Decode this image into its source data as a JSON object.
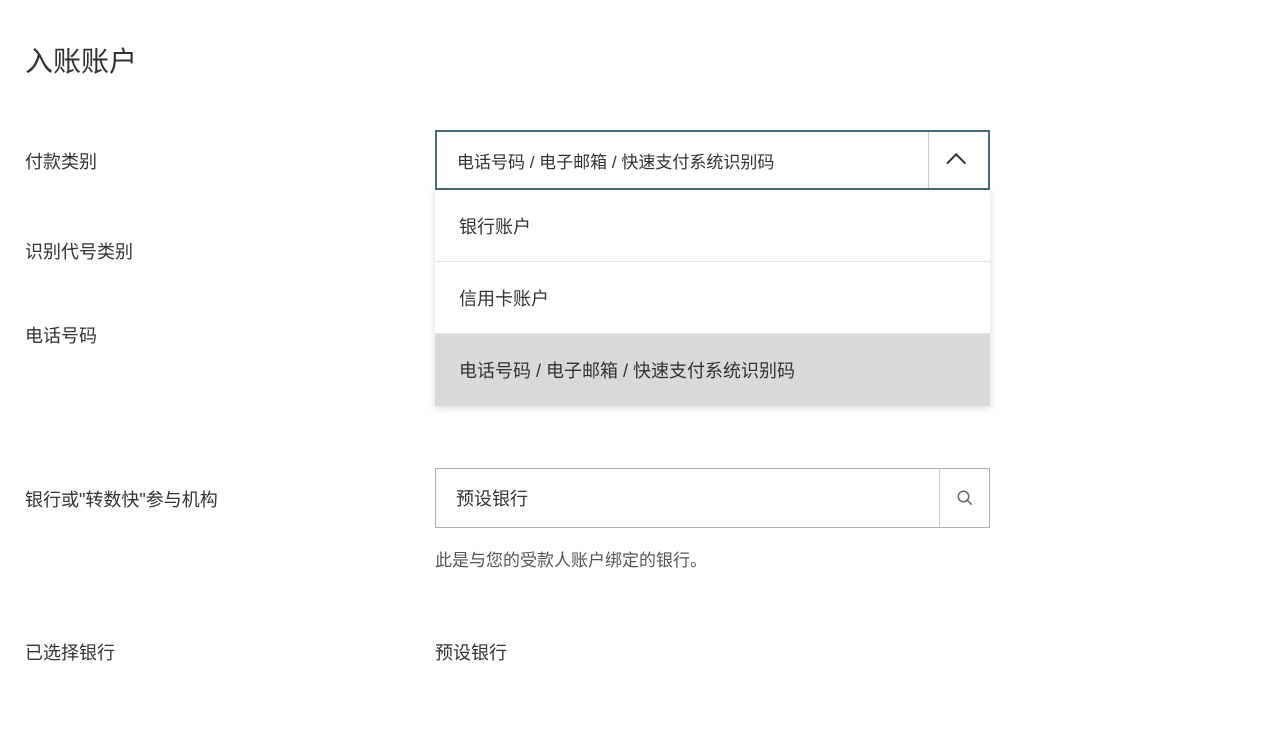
{
  "page": {
    "title": "入账账户"
  },
  "form": {
    "payment_type": {
      "label": "付款类别",
      "selected": "电话号码 / 电子邮箱 / 快速支付系统识别码",
      "options": [
        "银行账户",
        "信用卡账户",
        "电话号码 / 电子邮箱 / 快速支付系统识别码"
      ]
    },
    "identifier_type": {
      "label": "识别代号类别"
    },
    "phone_number": {
      "label": "电话号码"
    },
    "bank_institution": {
      "label": "银行或\"转数快\"参与机构",
      "value": "预设银行",
      "helper": "此是与您的受款人账户绑定的银行。"
    },
    "selected_bank": {
      "label": "已选择银行",
      "value": "预设银行"
    }
  }
}
